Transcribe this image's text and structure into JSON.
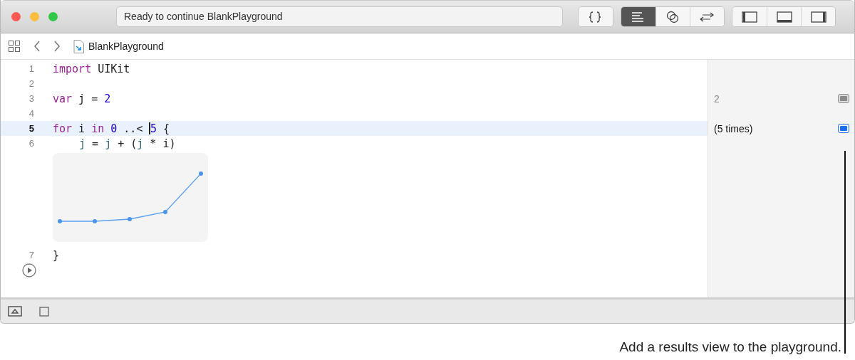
{
  "status_field": {
    "text": "Ready to continue BlankPlayground"
  },
  "toolbar_groups": [
    [
      {
        "selected": false
      }
    ],
    [
      {
        "selected": true
      },
      {
        "selected": false
      },
      {
        "selected": false
      }
    ],
    [
      {
        "selected": false
      },
      {
        "selected": false
      },
      {
        "selected": false
      }
    ]
  ],
  "jump_bar": {
    "file": "BlankPlayground"
  },
  "lines": [
    {
      "number": "1",
      "current": false,
      "tokens": [
        {
          "text": "import",
          "kind": "keyword"
        },
        {
          "text": " UIKit",
          "kind": "plain"
        }
      ]
    },
    {
      "number": "2",
      "current": false
    },
    {
      "number": "3",
      "current": false,
      "tokens": [
        {
          "text": "var",
          "kind": "keyword"
        },
        {
          "text": " j = ",
          "kind": "plain"
        },
        {
          "text": "2",
          "kind": "number"
        }
      ],
      "result": {
        "text": "2",
        "on": false
      }
    },
    {
      "number": "4",
      "current": false
    },
    {
      "number": "5",
      "current": true,
      "tokens": [
        {
          "text": "for",
          "kind": "keyword"
        },
        {
          "text": " i ",
          "kind": "plain"
        },
        {
          "text": "in",
          "kind": "keyword"
        },
        {
          "text": " 0",
          "kind": "number"
        },
        {
          "text": " ..< ",
          "kind": "plain"
        },
        {
          "text": "5",
          "kind": "number",
          "cursor": true
        },
        {
          "text": " {",
          "kind": "plain"
        }
      ],
      "result": {
        "text": "(5 times)",
        "on": true
      }
    },
    {
      "number": "6",
      "current": false,
      "indented": true,
      "tokens": [
        {
          "text": "j",
          "kind": "variable"
        },
        {
          "text": " = ",
          "kind": "plain"
        },
        {
          "text": "j",
          "kind": "variable"
        },
        {
          "text": " + (",
          "kind": "plain"
        },
        {
          "text": "j",
          "kind": "variable"
        },
        {
          "text": " * i)",
          "kind": "plain"
        }
      ],
      "inline_result": {
        "kind": "picture"
      }
    },
    {
      "number": "7",
      "current": false,
      "tokens": [
        {
          "text": "}",
          "kind": "plain"
        }
      ]
    }
  ],
  "caption": "Add a results view to the playground."
}
